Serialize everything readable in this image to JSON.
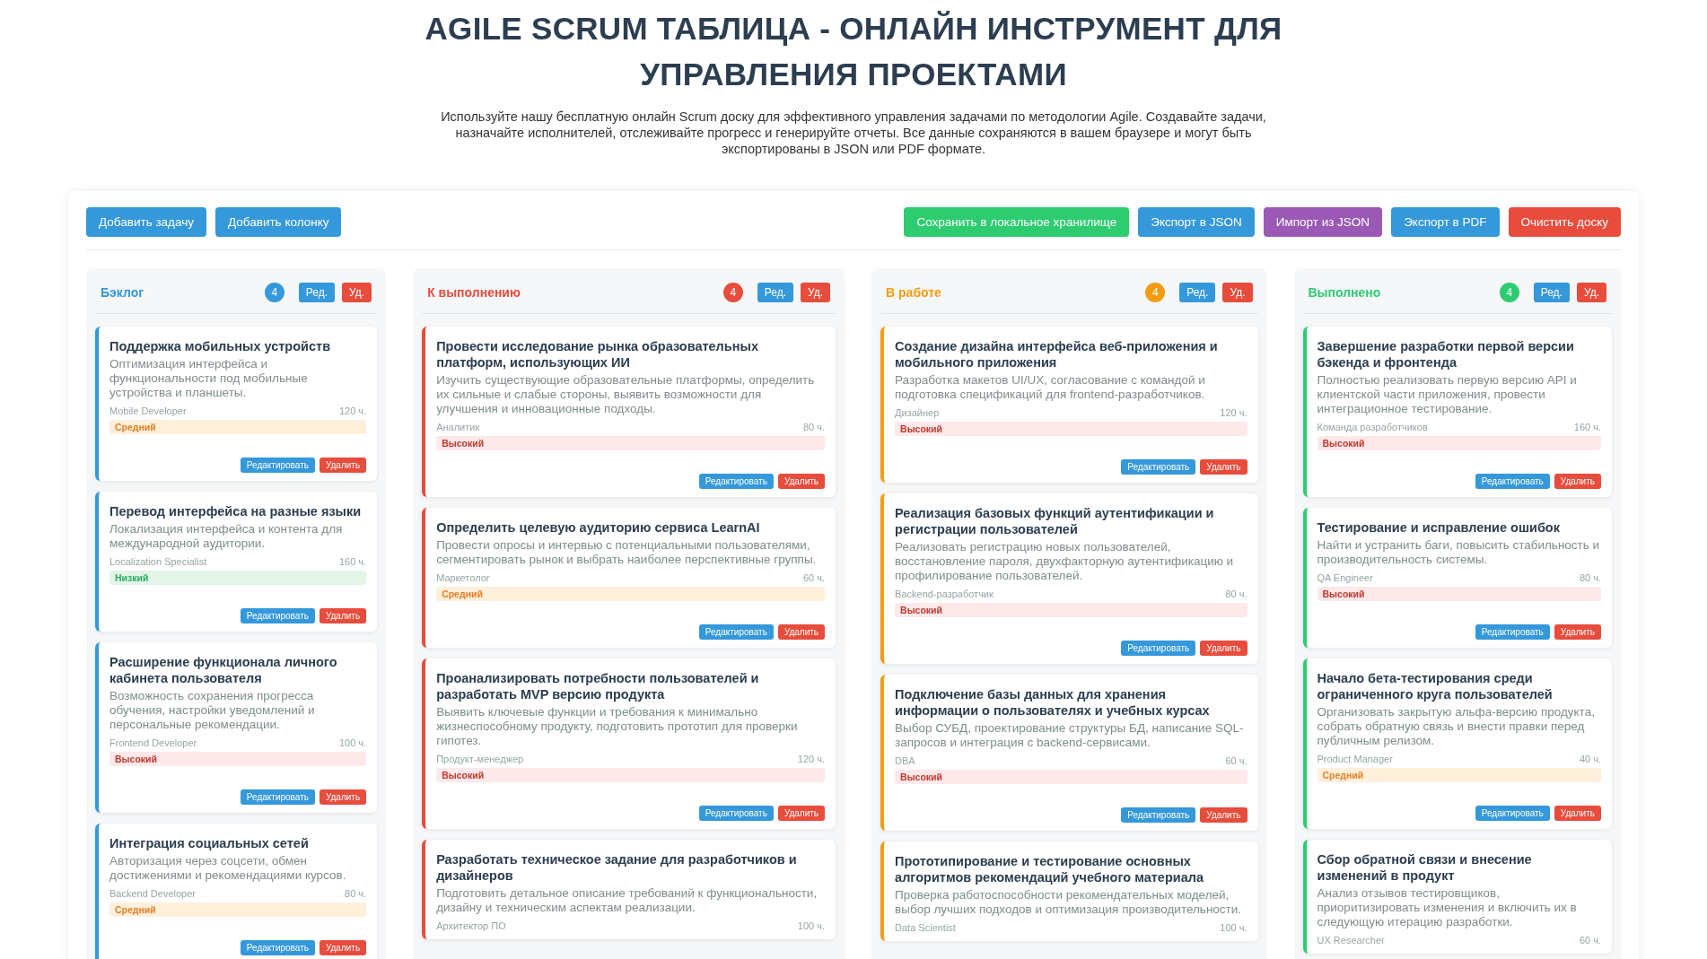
{
  "title": "AGILE SCRUM ТАБЛИЦА - ОНЛАЙН ИНСТРУМЕНТ ДЛЯ УПРАВЛЕНИЯ ПРОЕКТАМИ",
  "intro": "Используйте нашу бесплатную онлайн Scrum доску для эффективного управления задачами по методологии Agile. Создавайте задачи, назначайте исполнителей, отслеживайте прогресс и генерируйте отчеты. Все данные сохраняются в вашем браузере и могут быть экспортированы в JSON или PDF формате.",
  "toolbar_left": [
    {
      "label": "Добавить задачу",
      "kind": "primary"
    },
    {
      "label": "Добавить колонку",
      "kind": "primary"
    }
  ],
  "toolbar_right": [
    {
      "label": "Сохранить в локальное хранилище",
      "kind": "success"
    },
    {
      "label": "Экспорт в JSON",
      "kind": "primary"
    },
    {
      "label": "Импорт из JSON",
      "kind": "purple"
    },
    {
      "label": "Экспорт в PDF",
      "kind": "primary"
    },
    {
      "label": "Очистить доску",
      "kind": "danger"
    }
  ],
  "columns": [
    {
      "name": "Бэклог",
      "color": "#3498db",
      "count": "4",
      "edit": "Ред.",
      "delete": "Уд.",
      "cards": [
        {
          "title": "Поддержка мобильных устройств",
          "description": "Оптимизация интерфейса и функциональности под мобильные устройства и планшеты.",
          "assignee": "Mobile Developer",
          "hours": "120 ч.",
          "priority": "Средний",
          "kind": "medium",
          "edit": "Редактировать",
          "delete": "Удалить"
        },
        {
          "title": "Перевод интерфейса на разные языки",
          "description": "Локализация интерфейса и контента для международной аудитории.",
          "assignee": "Localization Specialist",
          "hours": "160 ч.",
          "priority": "Низкий",
          "kind": "low",
          "edit": "Редактировать",
          "delete": "Удалить"
        },
        {
          "title": "Расширение функционала личного кабинета пользователя",
          "description": "Возможность сохранения прогресса обучения, настройки уведомлений и персональные рекомендации.",
          "assignee": "Frontend Developer",
          "hours": "100 ч.",
          "priority": "Высокий",
          "kind": "high",
          "edit": "Редактировать",
          "delete": "Удалить"
        },
        {
          "title": "Интеграция социальных сетей",
          "description": "Авторизация через соцсети, обмен достижениями и рекомендациями курсов.",
          "assignee": "Backend Developer",
          "hours": "80 ч.",
          "priority": "Средний",
          "kind": "medium",
          "edit": "Редактировать",
          "delete": "Удалить"
        }
      ]
    },
    {
      "name": "К выполнению",
      "color": "#e74c3c",
      "count": "4",
      "edit": "Ред.",
      "delete": "Уд.",
      "cards": [
        {
          "title": "Провести исследование рынка образовательных платформ, использующих ИИ",
          "description": "Изучить существующие образовательные платформы, определить их сильные и слабые стороны, выявить возможности для улучшения и инновационные подходы.",
          "assignee": "Аналитик",
          "hours": "80 ч.",
          "priority": "Высокий",
          "kind": "high",
          "edit": "Редактировать",
          "delete": "Удалить"
        },
        {
          "title": "Определить целевую аудиторию сервиса LearnAI",
          "description": "Провести опросы и интервью с потенциальными пользователями, сегментировать рынок и выбрать наиболее перспективные группы.",
          "assignee": "Маркетолог",
          "hours": "60 ч.",
          "priority": "Средний",
          "kind": "medium",
          "edit": "Редактировать",
          "delete": "Удалить"
        },
        {
          "title": "Проанализировать потребности пользователей и разработать MVP версию продукта",
          "description": "Выявить ключевые функции и требования к минимально жизнеспособному продукту, подготовить прототип для проверки гипотез.",
          "assignee": "Продукт-менеджер",
          "hours": "120 ч.",
          "priority": "Высокий",
          "kind": "high",
          "edit": "Редактировать",
          "delete": "Удалить"
        },
        {
          "title": "Разработать техническое задание для разработчиков и дизайнеров",
          "description": "Подготовить детальное описание требований к функциональности, дизайну и техническим аспектам реализации.",
          "assignee": "Архитектор ПО",
          "hours": "100 ч."
        }
      ]
    },
    {
      "name": "В работе",
      "color": "#f39c12",
      "count": "4",
      "edit": "Ред.",
      "delete": "Уд.",
      "cards": [
        {
          "title": "Создание дизайна интерфейса веб-приложения и мобильного приложения",
          "description": "Разработка макетов UI/UX, согласование с командой и подготовка спецификаций для frontend-разработчиков.",
          "assignee": "Дизайнер",
          "hours": "120 ч.",
          "priority": "Высокий",
          "kind": "high",
          "edit": "Редактировать",
          "delete": "Удалить"
        },
        {
          "title": "Реализация базовых функций аутентификации и регистрации пользователей",
          "description": "Реализовать регистрацию новых пользователей, восстановление пароля, двухфакторную аутентификацию и профилирование пользователей.",
          "assignee": "Backend-разработчик",
          "hours": "80 ч.",
          "priority": "Высокий",
          "kind": "high",
          "edit": "Редактировать",
          "delete": "Удалить"
        },
        {
          "title": "Подключение базы данных для хранения информации о пользователях и учебных курсах",
          "description": "Выбор СУБД, проектирование структуры БД, написание SQL-запросов и интеграция с backend-сервисами.",
          "assignee": "DBA",
          "hours": "60 ч.",
          "priority": "Высокий",
          "kind": "high",
          "edit": "Редактировать",
          "delete": "Удалить"
        },
        {
          "title": "Прототипирование и тестирование основных алгоритмов рекомендаций учебного материала",
          "description": "Проверка работоспособности рекомендательных моделей, выбор лучших подходов и оптимизация производительности.",
          "assignee": "Data Scientist",
          "hours": "100 ч."
        }
      ]
    },
    {
      "name": "Выполнено",
      "color": "#2ecc71",
      "count": "4",
      "edit": "Ред.",
      "delete": "Уд.",
      "cards": [
        {
          "title": "Завершение разработки первой версии бэкенда и фронтенда",
          "description": "Полностью реализовать первую версию API и клиентской части приложения, провести интеграционное тестирование.",
          "assignee": "Команда разработчиков",
          "hours": "160 ч.",
          "priority": "Высокий",
          "kind": "high",
          "edit": "Редактировать",
          "delete": "Удалить"
        },
        {
          "title": "Тестирование и исправление ошибок",
          "description": "Найти и устранить баги, повысить стабильность и производительность системы.",
          "assignee": "QA Engineer",
          "hours": "80 ч.",
          "priority": "Высокий",
          "kind": "high",
          "edit": "Редактировать",
          "delete": "Удалить"
        },
        {
          "title": "Начало бета-тестирования среди ограниченного круга пользователей",
          "description": "Организовать закрытую альфа-версию продукта, собрать обратную связь и внести правки перед публичным релизом.",
          "assignee": "Product Manager",
          "hours": "40 ч.",
          "priority": "Средний",
          "kind": "medium",
          "edit": "Редактировать",
          "delete": "Удалить"
        },
        {
          "title": "Сбор обратной связи и внесение изменений в продукт",
          "description": "Анализ отзывов тестировщиков, приоритизировать изменения и включить их в следующую итерацию разработки.",
          "assignee": "UX Researcher",
          "hours": "60 ч."
        }
      ]
    }
  ]
}
